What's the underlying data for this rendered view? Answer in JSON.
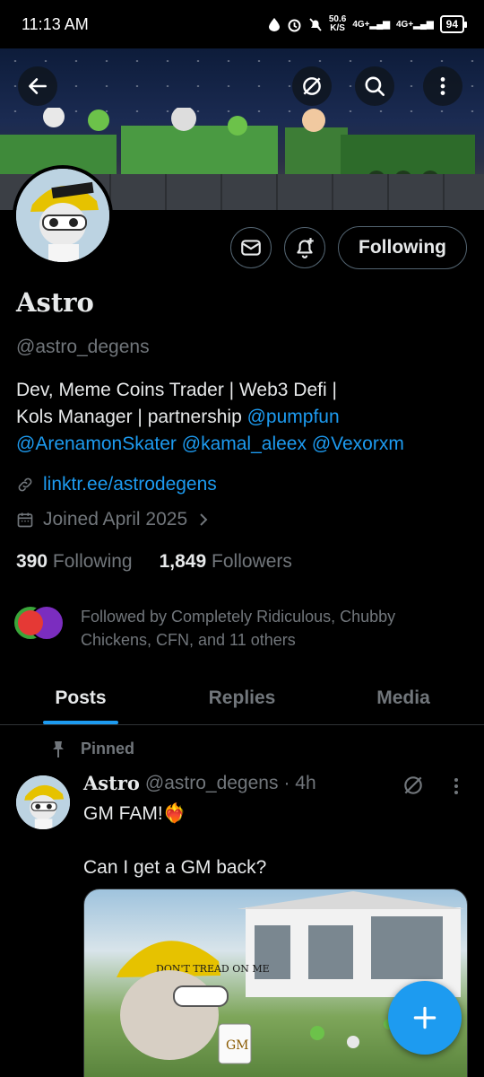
{
  "status_bar": {
    "time": "11:13 AM",
    "net_speed": "50.6",
    "net_unit": "K/S",
    "signal_1": "4G+",
    "signal_2": "4G+",
    "battery": "94"
  },
  "header_icons": [
    "back-arrow-icon",
    "grok-icon",
    "search-icon",
    "more-vertical-icon"
  ],
  "profile": {
    "name": "Astro",
    "handle": "@astro_degens",
    "bio_plain_1": "Dev, Meme Coins Trader | Web3 Defi |",
    "bio_plain_2": "Kols Manager | partnership ",
    "mentions": [
      "@pumpfun",
      "@ArenamonSkater",
      "@kamal_aleex",
      "@Vexorxm"
    ],
    "website": "linktr.ee/astrodegens",
    "joined": "Joined April 2025",
    "following_count": "390",
    "following_label": "Following",
    "followers_count": "1,849",
    "followers_label": "Followers",
    "followed_by": "Followed by Completely Ridiculous, Chubby Chickens, CFN, and 11 others",
    "follow_button": "Following"
  },
  "tabs": [
    {
      "label": "Posts",
      "active": true
    },
    {
      "label": "Replies",
      "active": false
    },
    {
      "label": "Media",
      "active": false
    }
  ],
  "pinned_post": {
    "pinned_label": "Pinned",
    "author": "Astro",
    "handle": "@astro_degens",
    "time": "· 4h",
    "text_1": "GM FAM!❤️‍🔥",
    "text_2": "Can I get a GM back?",
    "image_caption_text": "DON'T TREAD ON ME",
    "mug_text": "GM"
  },
  "colors": {
    "accent": "#1d9bf0",
    "muted": "#71767b",
    "text": "#e7e9ea",
    "background": "#000000",
    "border": "#2f3336"
  }
}
